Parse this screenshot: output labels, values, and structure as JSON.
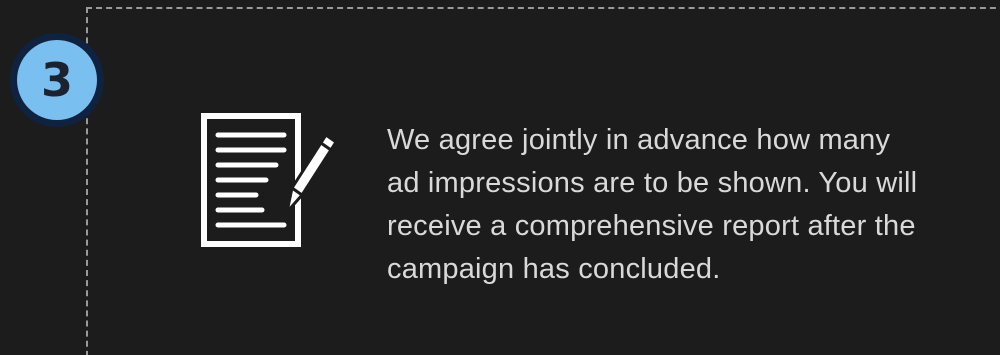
{
  "step": {
    "number": "3"
  },
  "icon": {
    "name": "document-edit-icon"
  },
  "description": {
    "lines": [
      "We agree jointly in advance how many",
      "ad impressions are to be shown. You will",
      "receive a comprehensive report after the",
      "campaign has concluded."
    ]
  },
  "colors": {
    "background": "#1c1c1c",
    "badge_fill": "#79bff0",
    "badge_ring": "#0f2340",
    "text": "#d9d9d9",
    "dashed_border": "#9a9a9a",
    "icon": "#ffffff"
  }
}
